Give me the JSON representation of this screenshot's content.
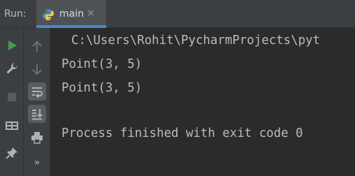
{
  "run_panel": {
    "label": "Run:",
    "tab": {
      "title": "main",
      "icon": "python-icon",
      "close_glyph": "×"
    }
  },
  "toolbar_primary": [
    {
      "name": "rerun-icon",
      "color": "#499c54"
    },
    {
      "name": "wrench-icon",
      "color": "#afb1b3"
    },
    {
      "name": "stop-icon",
      "color": "#5a5d5f"
    },
    {
      "name": "layout-icon",
      "color": "#afb1b3"
    },
    {
      "name": "pin-icon",
      "color": "#afb1b3"
    }
  ],
  "toolbar_secondary": [
    {
      "name": "up-arrow-icon"
    },
    {
      "name": "down-arrow-icon"
    },
    {
      "name": "soft-wrap-icon"
    },
    {
      "name": "scroll-to-end-icon"
    },
    {
      "name": "print-icon"
    },
    {
      "name": "more-icon",
      "glyph": "»"
    }
  ],
  "console": {
    "path": "C:\\Users\\Rohit\\PycharmProjects\\pyt",
    "lines": [
      "Point(3, 5)",
      "Point(3, 5)"
    ],
    "finish": "Process finished with exit code 0"
  },
  "colors": {
    "accent": "#4a88c7",
    "run_green": "#499c54",
    "background": "#2b2b2b",
    "panel": "#3c3f41"
  }
}
